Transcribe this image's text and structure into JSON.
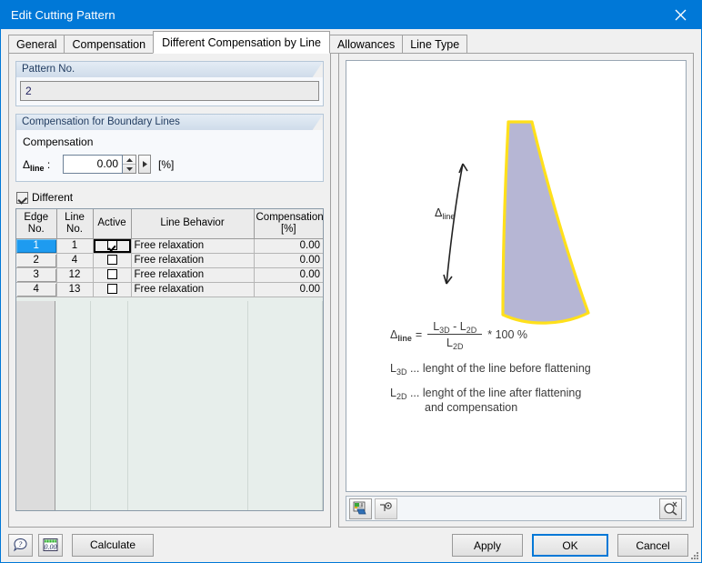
{
  "window": {
    "title": "Edit Cutting Pattern",
    "close_icon": "close-icon",
    "accent_color": "#0078d7"
  },
  "tabs": [
    {
      "label": "General",
      "active": false
    },
    {
      "label": "Compensation",
      "active": false
    },
    {
      "label": "Different Compensation by Line",
      "active": true
    },
    {
      "label": "Allowances",
      "active": false
    },
    {
      "label": "Line Type",
      "active": false
    }
  ],
  "pattern_group": {
    "header": "Pattern No.",
    "value": "2"
  },
  "compensation_group": {
    "header": "Compensation for Boundary Lines",
    "sub_label": "Compensation",
    "delta_label_prefix": "Δ",
    "delta_label_sub": "line",
    "delta_label_colon": " :",
    "value": "0.00",
    "unit": "[%]",
    "spinner_up_icon": "spinner-up-icon",
    "spinner_down_icon": "spinner-down-icon",
    "spinner_more_icon": "spinner-more-icon"
  },
  "different_checkbox": {
    "label": "Different",
    "checked": true
  },
  "table": {
    "headers": [
      {
        "line1": "Edge",
        "line2": "No."
      },
      {
        "line1": "Line",
        "line2": "No."
      },
      {
        "line1": "",
        "line2": "Active"
      },
      {
        "line1": "",
        "line2": "Line Behavior"
      },
      {
        "line1": "Compensation",
        "line2": "[%]"
      }
    ],
    "rows": [
      {
        "edge_no": "1",
        "line_no": "1",
        "active": true,
        "behavior": "Free relaxation",
        "compensation": "0.00",
        "selected": true,
        "focused": true
      },
      {
        "edge_no": "2",
        "line_no": "4",
        "active": false,
        "behavior": "Free relaxation",
        "compensation": "0.00",
        "selected": false,
        "focused": false
      },
      {
        "edge_no": "3",
        "line_no": "12",
        "active": false,
        "behavior": "Free relaxation",
        "compensation": "0.00",
        "selected": false,
        "focused": false
      },
      {
        "edge_no": "4",
        "line_no": "13",
        "active": false,
        "behavior": "Free relaxation",
        "compensation": "0.00",
        "selected": false,
        "focused": false
      }
    ]
  },
  "preview": {
    "shape_outline_color": "#ffe01b",
    "shape_fill_color": "#b6b6d4",
    "dimension_label_prefix": "Δ",
    "dimension_label_sub": "line",
    "formula": {
      "lhs_prefix": "Δ",
      "lhs_sub": "line",
      "equals": "=",
      "numerator_a": "L",
      "numerator_a_sub": "3D",
      "numerator_minus": "-",
      "numerator_b": "L",
      "numerator_b_sub": "2D",
      "denominator": "L",
      "denominator_sub": "2D",
      "multiplier": "* 100 %"
    },
    "legend": [
      {
        "sym": "L",
        "sub": "3D",
        "dots": "...",
        "text": "lenght of the line before flattening",
        "text2": ""
      },
      {
        "sym": "L",
        "sub": "2D",
        "dots": "...",
        "text": "lenght of the line after flattening",
        "text2": "and compensation"
      }
    ],
    "toolbar": {
      "render_icon": "render-colors-icon",
      "visibility_icon": "view-magnifier-icon",
      "zoom_icon": "zoom-reset-icon"
    }
  },
  "footer": {
    "help_icon": "help-question-icon",
    "decimals_icon": "decimal-places-icon",
    "calculate_label": "Calculate",
    "apply_label": "Apply",
    "ok_label": "OK",
    "cancel_label": "Cancel",
    "resize_grip_icon": "resize-grip-icon"
  }
}
